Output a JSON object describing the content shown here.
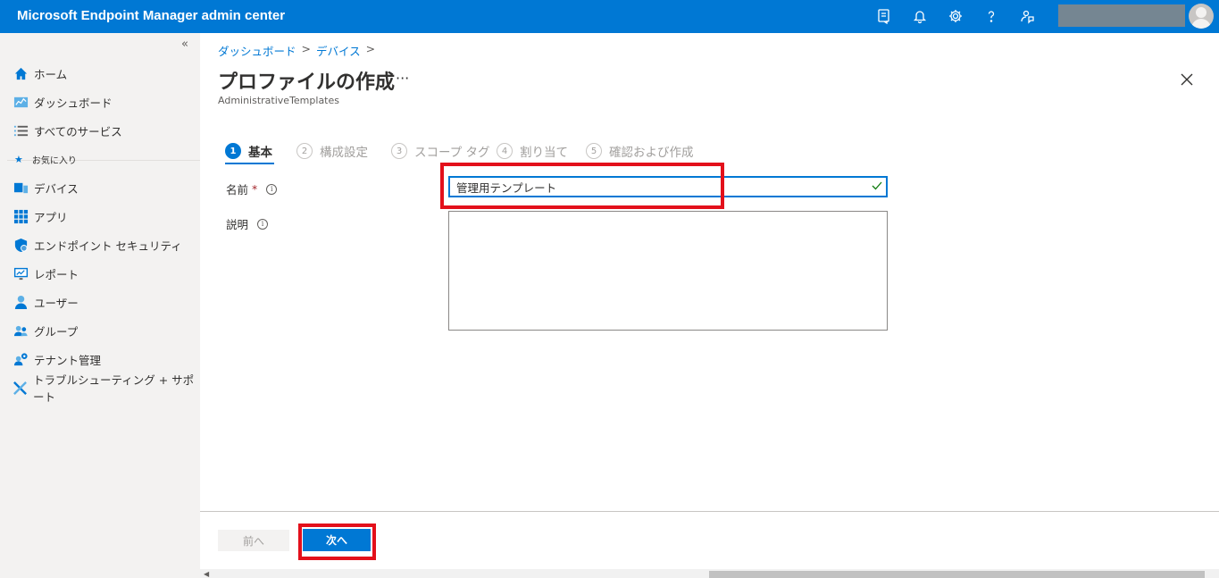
{
  "topbar": {
    "title": "Microsoft Endpoint Manager admin center",
    "icons": [
      "device-feedback-icon",
      "bell-icon",
      "gear-icon",
      "help-icon",
      "feedback-person-icon"
    ],
    "accent_color": "#0078d4"
  },
  "sidebar": {
    "collapse_glyph": "«",
    "items": [
      {
        "label": "ホーム",
        "icon": "home-icon"
      },
      {
        "label": "ダッシュボード",
        "icon": "dashboard-icon"
      },
      {
        "label": "すべてのサービス",
        "icon": "list-icon"
      }
    ],
    "favorites_label": "お気に入り",
    "favorites": [
      {
        "label": "デバイス",
        "icon": "devices-icon"
      },
      {
        "label": "アプリ",
        "icon": "apps-icon"
      },
      {
        "label": "エンドポイント セキュリティ",
        "icon": "shield-icon"
      },
      {
        "label": "レポート",
        "icon": "report-icon"
      },
      {
        "label": "ユーザー",
        "icon": "user-icon"
      },
      {
        "label": "グループ",
        "icon": "group-icon"
      },
      {
        "label": "テナント管理",
        "icon": "tenant-icon"
      },
      {
        "label": "トラブルシューティング + サポート",
        "icon": "tools-icon"
      }
    ]
  },
  "breadcrumb": [
    "ダッシュボード",
    "デバイス"
  ],
  "breadcrumb_sep": ">",
  "page": {
    "title": "プロファイルの作成",
    "more": "···",
    "subtitle": "AdministrativeTemplates"
  },
  "steps": [
    {
      "num": "1",
      "label": "基本"
    },
    {
      "num": "2",
      "label": "構成設定"
    },
    {
      "num": "3",
      "label": "スコープ タグ"
    },
    {
      "num": "4",
      "label": "割り当て"
    },
    {
      "num": "5",
      "label": "確認および作成"
    }
  ],
  "form": {
    "name_label": "名前",
    "required_mark": "*",
    "name_value": "管理用テンプレート",
    "description_label": "説明",
    "description_value": "",
    "info_glyph": "i"
  },
  "footer": {
    "prev_label": "前へ",
    "next_label": "次へ"
  },
  "highlight_color": "#e3101b"
}
